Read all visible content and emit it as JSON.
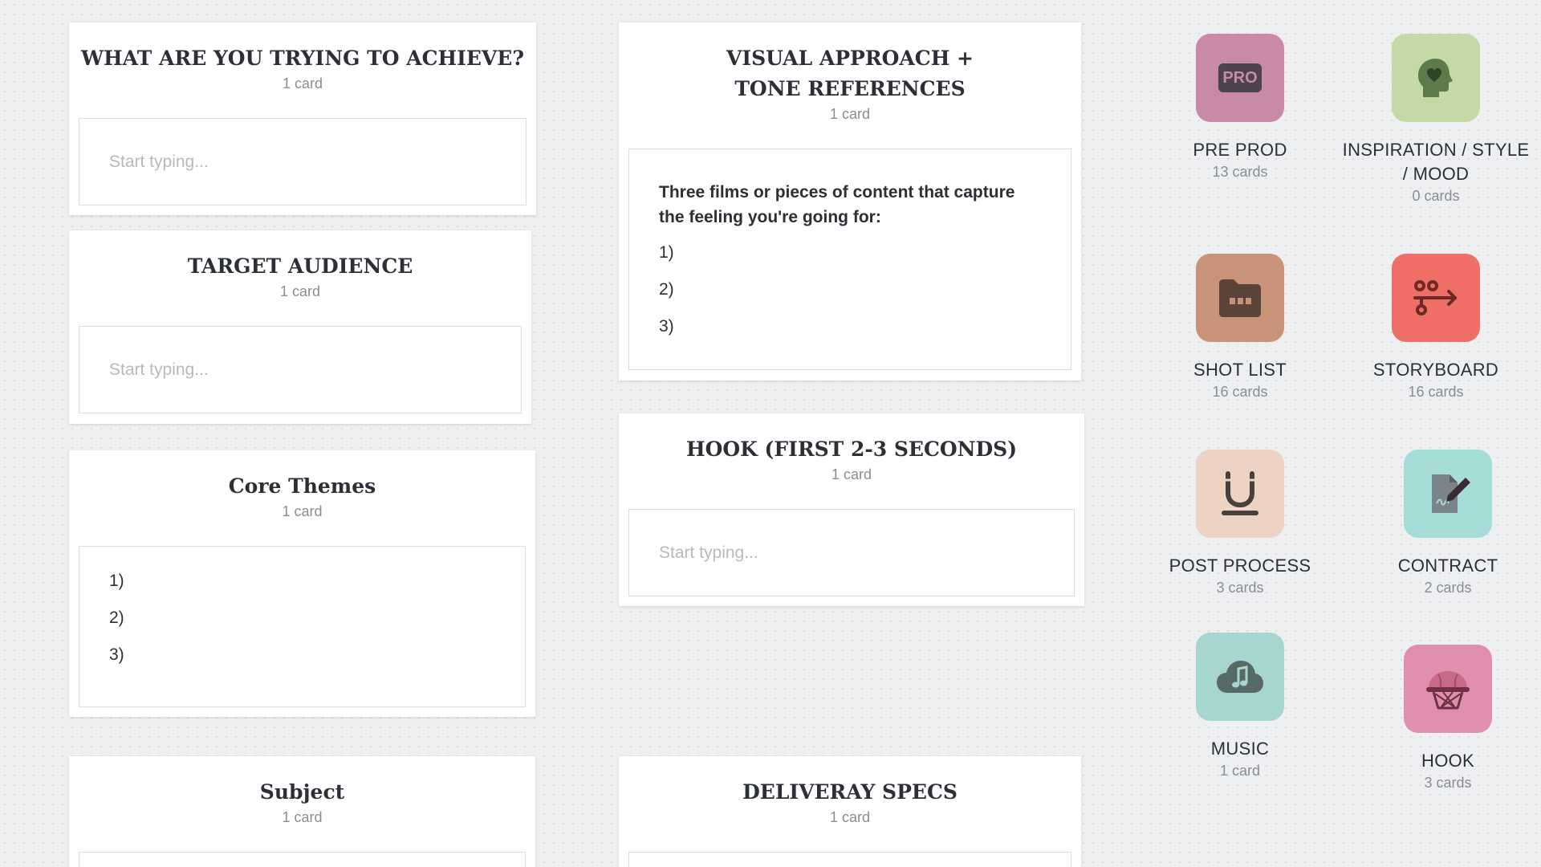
{
  "cards": {
    "achieve": {
      "title": "WHAT ARE YOU TRYING TO ACHIEVE?",
      "count": "1 card",
      "placeholder": "Start typing..."
    },
    "audience": {
      "title": "TARGET AUDIENCE",
      "count": "1 card",
      "placeholder": "Start typing..."
    },
    "themes": {
      "title": "Core Themes",
      "count": "1 card",
      "items": [
        "1)",
        "2)",
        "3)"
      ]
    },
    "subject": {
      "title": "Subject",
      "count": "1 card"
    },
    "visual": {
      "title_line1": "VISUAL APPROACH +",
      "title_line2": "TONE REFERENCES",
      "count": "1 card",
      "intro": "Three films or pieces of content that capture the feeling you're going for:",
      "items": [
        "1)",
        "2)",
        "3)"
      ]
    },
    "hook": {
      "title": "HOOK (FIRST 2-3 SECONDS)",
      "count": "1 card",
      "placeholder": "Start typing..."
    },
    "delivery": {
      "title": "DELIVERAY SPECS",
      "count": "1 card"
    }
  },
  "boards": [
    {
      "label": "PRE PROD",
      "count": "13 cards",
      "icon": "pro-badge-icon",
      "color": "#c98aa9",
      "badge_text": "PRO"
    },
    {
      "label_line1": "INSPIRATION / STYLE",
      "label_line2": "/ MOOD",
      "count": "0 cards",
      "icon": "head-heart-icon",
      "color": "#c5d9a6"
    },
    {
      "label": "SHOT LIST",
      "count": "16 cards",
      "icon": "folder-icon",
      "color": "#c9937a"
    },
    {
      "label": "STORYBOARD",
      "count": "16 cards",
      "icon": "flow-arrow-icon",
      "color": "#ef6f66"
    },
    {
      "label": "POST PROCESS",
      "count": "3 cards",
      "icon": "underline-icon",
      "color": "#ecd3c3"
    },
    {
      "label": "CONTRACT",
      "count": "2 cards",
      "icon": "document-sign-icon",
      "color": "#a6ddd8"
    },
    {
      "label": "MUSIC",
      "count": "1 card",
      "icon": "music-cloud-icon",
      "color": "#a6d6cf"
    },
    {
      "label": "HOOK",
      "count": "3 cards",
      "icon": "basketball-hoop-icon",
      "color": "#e18fae"
    }
  ]
}
